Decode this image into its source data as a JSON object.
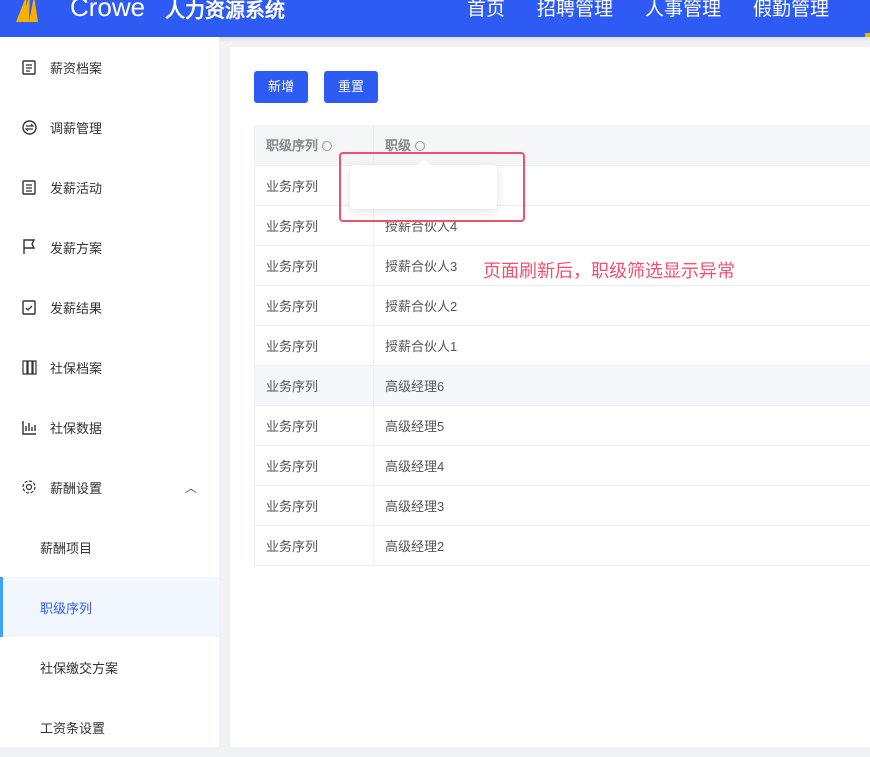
{
  "header": {
    "brand": "Crowe",
    "system_name": "人力资源系统",
    "nav": [
      "首页",
      "招聘管理",
      "人事管理",
      "假勤管理"
    ]
  },
  "sidebar": {
    "items": [
      {
        "label": "薪资档案",
        "icon": "document-icon"
      },
      {
        "label": "调薪管理",
        "icon": "exchange-icon"
      },
      {
        "label": "发薪活动",
        "icon": "clipboard-icon"
      },
      {
        "label": "发薪方案",
        "icon": "flag-icon"
      },
      {
        "label": "发薪结果",
        "icon": "clipboard-check-icon"
      },
      {
        "label": "社保档案",
        "icon": "grid-icon"
      },
      {
        "label": "社保数据",
        "icon": "bar-chart-icon"
      },
      {
        "label": "薪酬设置",
        "icon": "gear-icon",
        "expanded": true
      }
    ],
    "sub_items": [
      {
        "label": "薪酬项目"
      },
      {
        "label": "职级序列",
        "active": true
      },
      {
        "label": "社保缴交方案"
      },
      {
        "label": "工资条设置"
      }
    ]
  },
  "toolbar": {
    "add_label": "新增",
    "reset_label": "重置"
  },
  "table": {
    "columns": [
      "职级序列",
      "职级"
    ],
    "rows": [
      [
        "业务序列",
        ""
      ],
      [
        "业务序列",
        "授薪合伙人4"
      ],
      [
        "业务序列",
        "授薪合伙人3"
      ],
      [
        "业务序列",
        "授薪合伙人2"
      ],
      [
        "业务序列",
        "授薪合伙人1"
      ],
      [
        "业务序列",
        "高级经理6"
      ],
      [
        "业务序列",
        "高级经理5"
      ],
      [
        "业务序列",
        "高级经理4"
      ],
      [
        "业务序列",
        "高级经理3"
      ],
      [
        "业务序列",
        "高级经理2"
      ]
    ]
  },
  "annotation": {
    "text": "页面刷新后，职级筛选显示异常",
    "color": "#f0506e"
  },
  "colors": {
    "primary": "#2f5bf5"
  }
}
